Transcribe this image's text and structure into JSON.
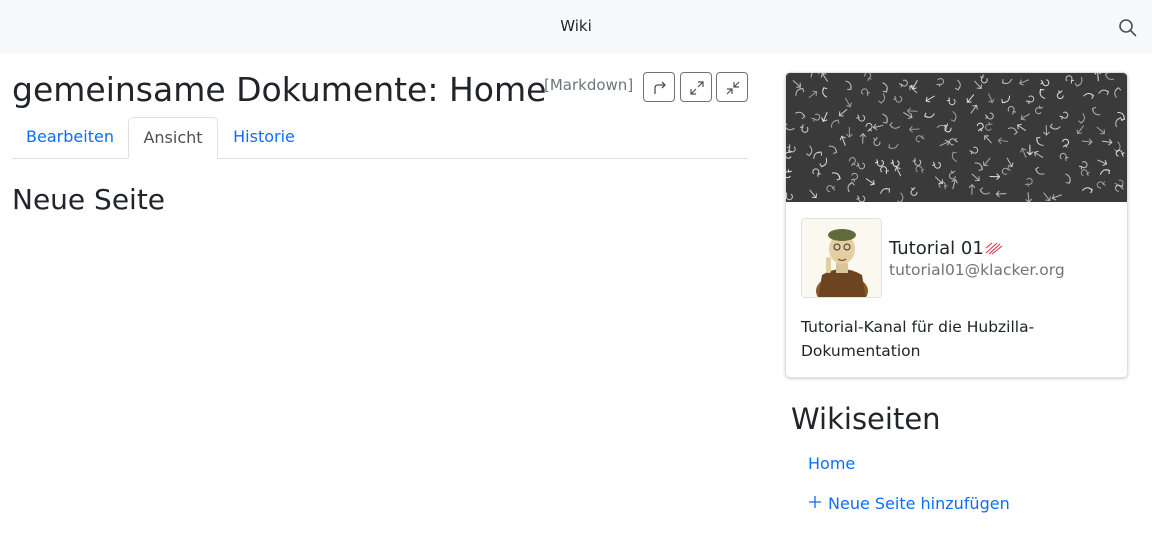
{
  "app": {
    "title": "Wiki"
  },
  "page": {
    "title": "gemeinsame Dokumente: Home",
    "mimetype_label": "[Markdown]",
    "tabs": [
      {
        "label": "Bearbeiten",
        "active": false
      },
      {
        "label": "Ansicht",
        "active": true
      },
      {
        "label": "Historie",
        "active": false
      }
    ],
    "content_heading": "Neue Seite"
  },
  "channel": {
    "name": "Tutorial 01",
    "address": "tutorial01@klacker.org",
    "description": "Tutorial-Kanal für die Hubzilla-Dokumentation"
  },
  "sidebar": {
    "heading": "Wikiseiten",
    "links": [
      {
        "label": "Home"
      },
      {
        "label": "Neue Seite hinzufügen"
      }
    ]
  },
  "colors": {
    "link": "#0d6efd",
    "muted": "#6c757d",
    "topbar": "#f8f9fa",
    "accent_icon": "#dc3545"
  },
  "icons": [
    "search-icon",
    "share-icon",
    "expand-icon",
    "compress-icon",
    "zot-icon",
    "plus-icon"
  ]
}
